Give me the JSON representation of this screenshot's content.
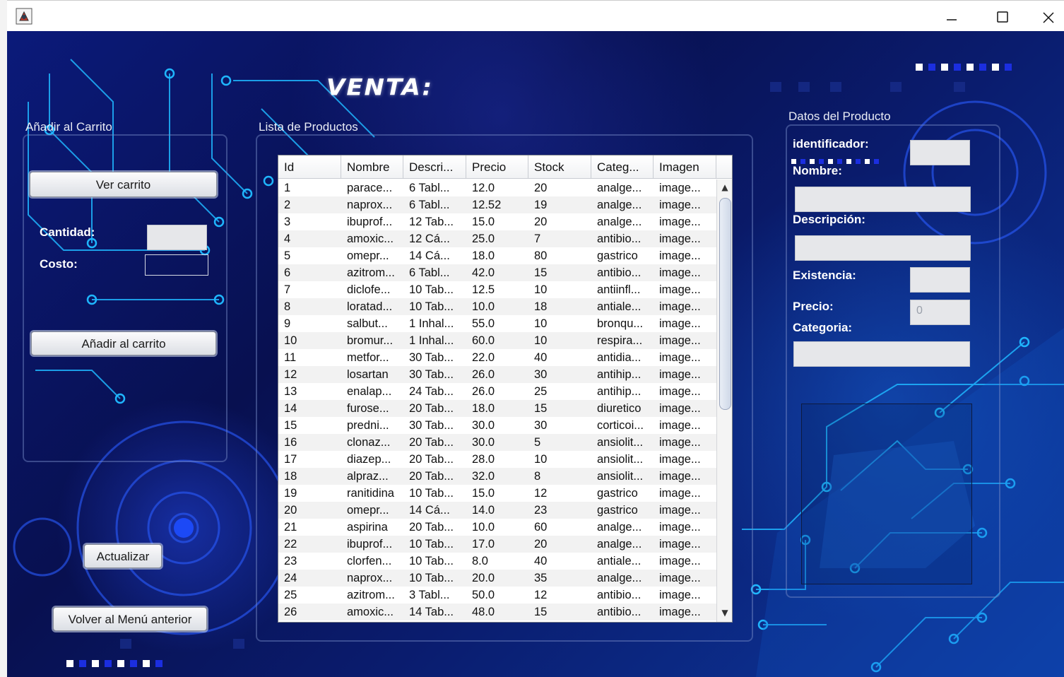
{
  "window": {
    "minimize_glyph": "—",
    "maximize_glyph": "☐",
    "close_glyph": "✕"
  },
  "heading": "VENTA:",
  "cart_panel": {
    "title": "Añadir al Carrito",
    "view_cart_label": "Ver carrito",
    "quantity_label": "Cantidad:",
    "quantity_value": "",
    "cost_label": "Costo:",
    "cost_value": "",
    "add_button_label": "Añadir al carrito"
  },
  "refresh_label": "Actualizar",
  "back_label": "Volver al Menú anterior",
  "products_panel": {
    "title": "Lista de Productos",
    "columns": [
      "Id",
      "Nombre",
      "Descri...",
      "Precio",
      "Stock",
      "Categ...",
      "Imagen"
    ],
    "rows": [
      [
        "1",
        "parace...",
        "6 Tabl...",
        "12.0",
        "20",
        "analge...",
        "image..."
      ],
      [
        "2",
        "naprox...",
        "6 Tabl...",
        "12.52",
        "19",
        "analge...",
        "image..."
      ],
      [
        "3",
        "ibuprof...",
        "12 Tab...",
        "15.0",
        "20",
        "analge...",
        "image..."
      ],
      [
        "4",
        "amoxic...",
        "12 Cá...",
        "25.0",
        "7",
        "antibio...",
        "image..."
      ],
      [
        "5",
        "omepr...",
        "14 Cá...",
        "18.0",
        "80",
        "gastrico",
        "image..."
      ],
      [
        "6",
        "azitrom...",
        "6 Tabl...",
        "42.0",
        "15",
        "antibio...",
        "image..."
      ],
      [
        "7",
        "diclofe...",
        "10 Tab...",
        "12.5",
        "10",
        "antiinfl...",
        "image..."
      ],
      [
        "8",
        "loratad...",
        "10 Tab...",
        "10.0",
        "18",
        "antiale...",
        "image..."
      ],
      [
        "9",
        "salbut...",
        "1 Inhal...",
        "55.0",
        "10",
        "bronqu...",
        "image..."
      ],
      [
        "10",
        "bromur...",
        "1 Inhal...",
        "60.0",
        "10",
        "respira...",
        "image..."
      ],
      [
        "11",
        "metfor...",
        "30 Tab...",
        "22.0",
        "40",
        "antidia...",
        "image..."
      ],
      [
        "12",
        "losartan",
        "30 Tab...",
        "26.0",
        "30",
        "antihip...",
        "image..."
      ],
      [
        "13",
        "enalap...",
        "24 Tab...",
        "26.0",
        "25",
        "antihip...",
        "image..."
      ],
      [
        "14",
        "furose...",
        "20 Tab...",
        "18.0",
        "15",
        "diuretico",
        "image..."
      ],
      [
        "15",
        "predni...",
        "30 Tab...",
        "30.0",
        "30",
        "corticoi...",
        "image..."
      ],
      [
        "16",
        "clonaz...",
        "20 Tab...",
        "30.0",
        "5",
        "ansiolit...",
        "image..."
      ],
      [
        "17",
        "diazep...",
        "20 Tab...",
        "28.0",
        "10",
        "ansiolit...",
        "image..."
      ],
      [
        "18",
        "alpraz...",
        "20 Tab...",
        "32.0",
        "8",
        "ansiolit...",
        "image..."
      ],
      [
        "19",
        "ranitidina",
        "10 Tab...",
        "15.0",
        "12",
        "gastrico",
        "image..."
      ],
      [
        "20",
        "omepr...",
        "14 Cá...",
        "14.0",
        "23",
        "gastrico",
        "image..."
      ],
      [
        "21",
        "aspirina",
        "20 Tab...",
        "10.0",
        "60",
        "analge...",
        "image..."
      ],
      [
        "22",
        "ibuprof...",
        "10 Tab...",
        "17.0",
        "20",
        "analge...",
        "image..."
      ],
      [
        "23",
        "clorfen...",
        "10 Tab...",
        "8.0",
        "40",
        "antiale...",
        "image..."
      ],
      [
        "24",
        "naprox...",
        "10 Tab...",
        "20.0",
        "35",
        "analge...",
        "image..."
      ],
      [
        "25",
        "azitrom...",
        "3 Tabl...",
        "50.0",
        "12",
        "antibio...",
        "image..."
      ],
      [
        "26",
        "amoxic...",
        "14 Tab...",
        "48.0",
        "15",
        "antibio...",
        "image..."
      ]
    ],
    "scroll_up_glyph": "▲",
    "scroll_down_glyph": "▼"
  },
  "details_panel": {
    "title": "Datos del Producto",
    "id_label": "identificador:",
    "id_value": "",
    "name_label": "Nombre:",
    "name_value": "",
    "description_label": "Descripción:",
    "description_value": "",
    "stock_label": "Existencia:",
    "stock_value": "",
    "price_label": "Precio:",
    "price_value": "0",
    "category_label": "Categoria:",
    "category_value": ""
  },
  "colors": {
    "background_dark": "#081050",
    "circuit_cyan": "#1fb6ff",
    "field_bg": "#e6e7ea"
  },
  "icons": [
    "app-java-icon",
    "minimize-icon",
    "maximize-icon",
    "close-icon",
    "scroll-up-icon",
    "scroll-down-icon"
  ]
}
